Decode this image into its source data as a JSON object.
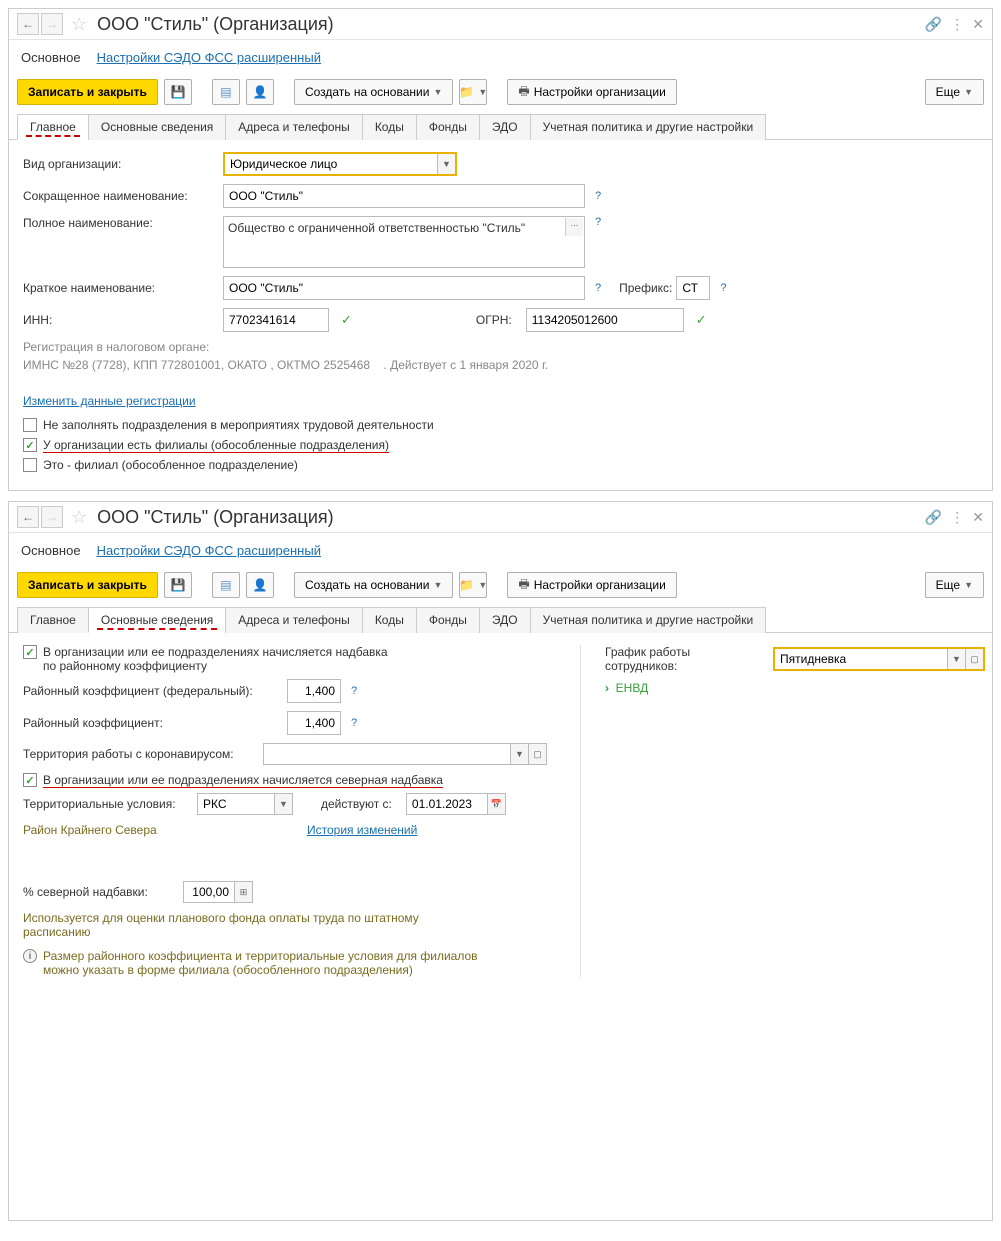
{
  "window1": {
    "title": "ООО \"Стиль\" (Организация)",
    "nav_tabs": {
      "main": "Основное",
      "link": "Настройки СЭДО ФСС расширенный"
    },
    "toolbar": {
      "save_close": "Записать и закрыть",
      "create_on": "Создать на основании",
      "org_settings": "Настройки организации",
      "more": "Еще"
    },
    "tabs": [
      "Главное",
      "Основные сведения",
      "Адреса и телефоны",
      "Коды",
      "Фонды",
      "ЭДО",
      "Учетная политика и другие настройки"
    ],
    "form": {
      "org_type_label": "Вид организации:",
      "org_type_value": "Юридическое лицо",
      "short_name_label": "Сокращенное наименование:",
      "short_name_value": "ООО \"Стиль\"",
      "full_name_label": "Полное наименование:",
      "full_name_value": "Общество с ограниченной ответственностью \"Стиль\"",
      "brief_name_label": "Краткое наименование:",
      "brief_name_value": "ООО \"Стиль\"",
      "prefix_label": "Префикс:",
      "prefix_value": "СТ",
      "inn_label": "ИНН:",
      "inn_value": "7702341614",
      "ogrn_label": "ОГРН:",
      "ogrn_value": "1134205012600",
      "reg_header": "Регистрация в налоговом органе:",
      "reg_value": "ИМНС №28 (7728), КПП 772801001, ОКАТО , ОКТМО 2525468",
      "reg_valid": ". Действует с 1 января 2020 г.",
      "change_reg_link": "Изменить данные регистрации",
      "cb1": "Не заполнять подразделения в мероприятиях трудовой деятельности",
      "cb2": "У организации есть филиалы (обособленные подразделения)",
      "cb3": "Это - филиал (обособленное подразделение)"
    }
  },
  "window2": {
    "title": "ООО \"Стиль\" (Организация)",
    "nav_tabs": {
      "main": "Основное",
      "link": "Настройки СЭДО ФСС расширенный"
    },
    "toolbar": {
      "save_close": "Записать и закрыть",
      "create_on": "Создать на основании",
      "org_settings": "Настройки организации",
      "more": "Еще"
    },
    "tabs": [
      "Главное",
      "Основные сведения",
      "Адреса и телефоны",
      "Коды",
      "Фонды",
      "ЭДО",
      "Учетная политика и другие настройки"
    ],
    "left": {
      "cb_region": "В организации или ее подразделениях начисляется надбавка по районному коэффициенту",
      "rk_fed_label": "Районный коэффициент (федеральный):",
      "rk_fed_value": "1,400",
      "rk_label": "Районный коэффициент:",
      "rk_value": "1,400",
      "terr_covid_label": "Территория работы с коронавирусом:",
      "cb_north": "В организации или ее подразделениях начисляется северная надбавка",
      "terr_cond_label": "Территориальные условия:",
      "terr_cond_value": "РКС",
      "valid_from_label": "действуют с:",
      "valid_from_value": "01.01.2023",
      "rks_text": "Район Крайнего Севера",
      "history_link": "История изменений",
      "pct_north_label": "% северной надбавки:",
      "pct_north_value": "100,00",
      "olive_text": "Используется для оценки планового фонда оплаты труда по штатному расписанию",
      "info_text": "Размер районного коэффициента и территориальные условия для филиалов можно указать в форме филиала (обособленного подразделения)"
    },
    "right": {
      "schedule_label": "График работы сотрудников:",
      "schedule_value": "Пятидневка",
      "expand_envd": "ЕНВД"
    }
  }
}
